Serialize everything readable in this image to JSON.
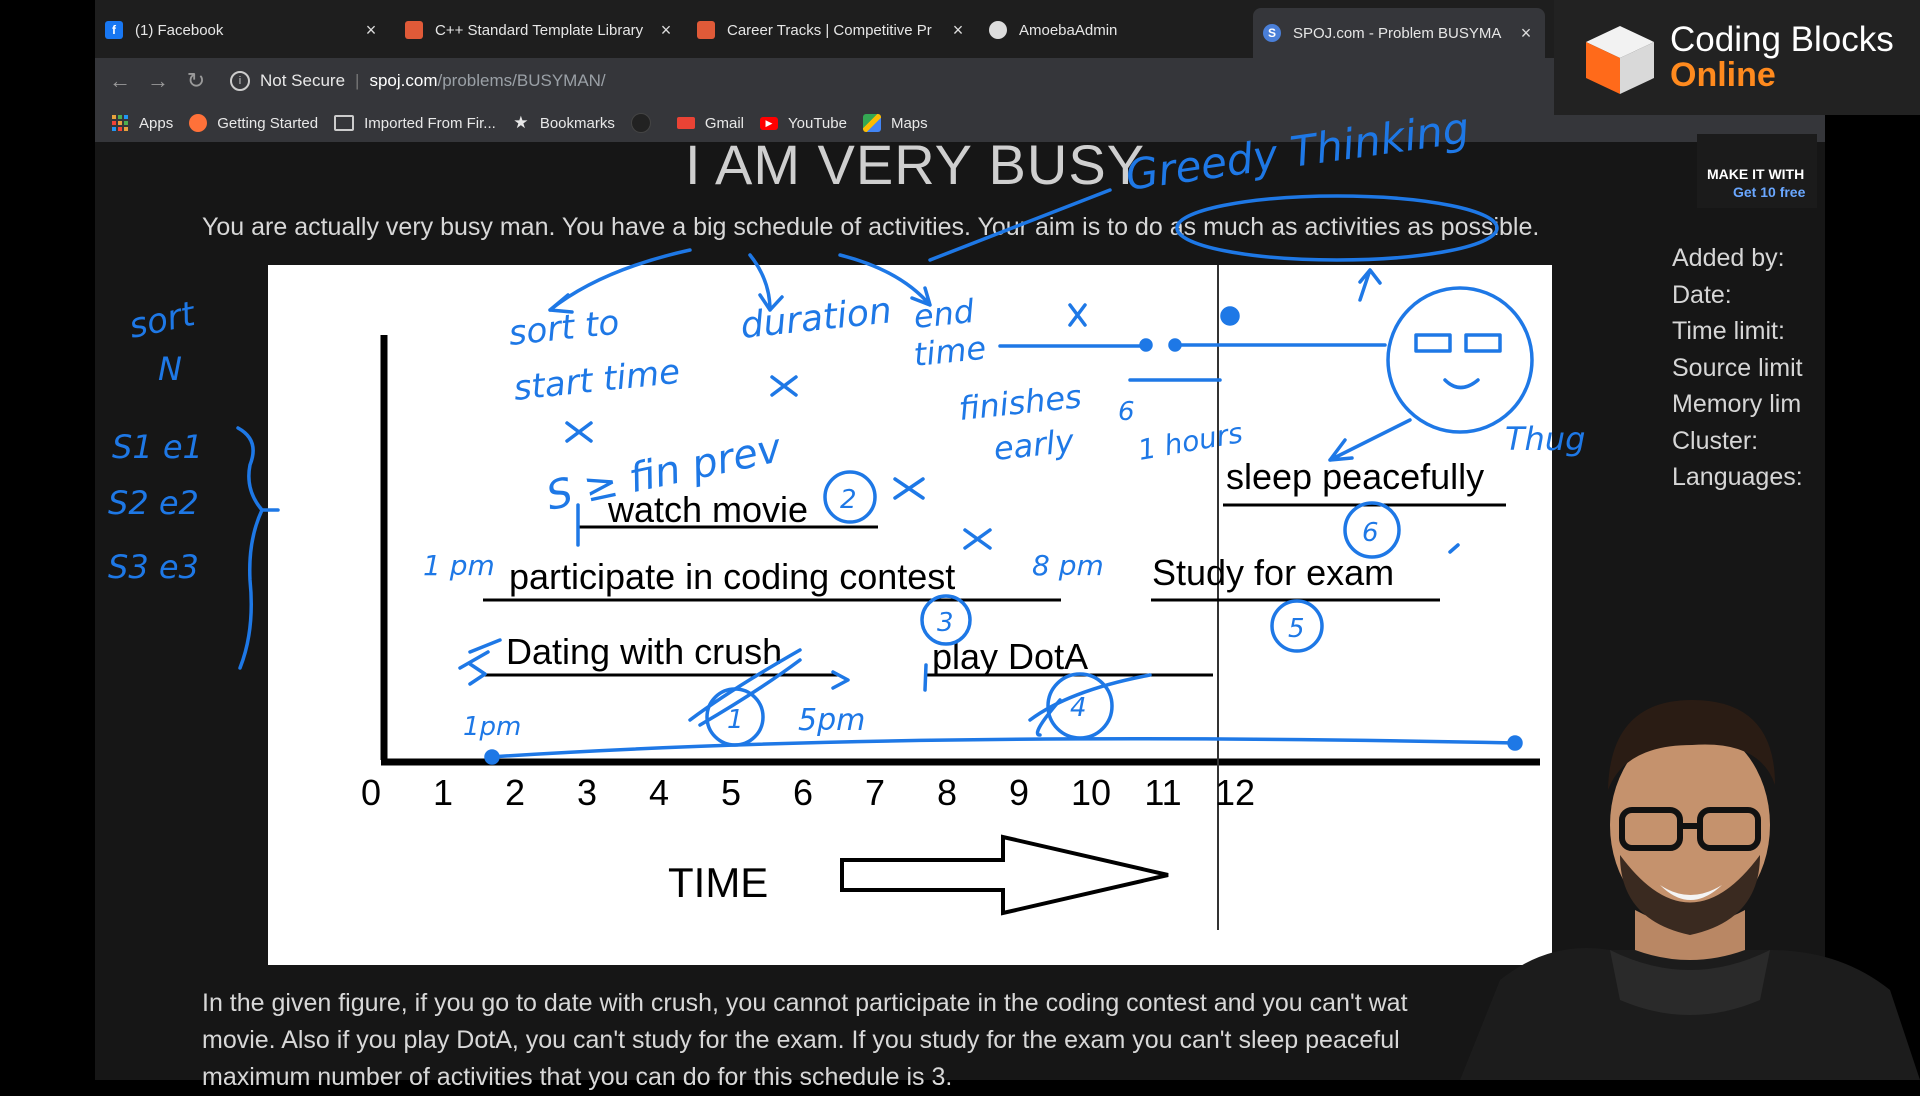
{
  "tabs": [
    {
      "title": "(1) Facebook",
      "favicon_color": "#1877f2",
      "favicon_glyph": "f"
    },
    {
      "title": "C++ Standard Template Library",
      "favicon_color": "#e05a38",
      "favicon_glyph": ""
    },
    {
      "title": "Career Tracks | Competitive Pr",
      "favicon_color": "#e05a38",
      "favicon_glyph": ""
    },
    {
      "title": "AmoebaAdmin",
      "favicon_color": "#dcdcdc",
      "favicon_glyph": ""
    },
    {
      "title": "SPOJ.com - Problem BUSYMA",
      "favicon_color": "#4a7fd8",
      "favicon_glyph": "S"
    }
  ],
  "address_bar": {
    "security": "Not Secure",
    "host": "spoj.com",
    "path": "/problems/BUSYMAN/"
  },
  "bookmarks": [
    {
      "label": "Apps",
      "icon": "apps-grid-icon"
    },
    {
      "label": "Getting Started",
      "icon": "firefox-icon"
    },
    {
      "label": "Imported From Fir...",
      "icon": "folder-icon"
    },
    {
      "label": "Bookmarks",
      "icon": "star-icon"
    },
    {
      "label": "",
      "icon": "github-icon"
    },
    {
      "label": "Gmail",
      "icon": "gmail-icon"
    },
    {
      "label": "YouTube",
      "icon": "youtube-icon"
    },
    {
      "label": "Maps",
      "icon": "maps-icon"
    }
  ],
  "problem": {
    "title": "I AM VERY BUSY",
    "intro": "You are actually very busy man. You have a big schedule of activities. Your aim is to do as much as activities as possible.",
    "meta_labels": [
      "Added by:",
      "Date:",
      "Time limit:",
      "Source limit",
      "Memory lim",
      "Cluster:",
      "Languages:"
    ],
    "description_lines": [
      "In the given figure, if you go to date with crush, you cannot participate in the coding contest and you can't wat",
      "movie. Also if you play DotA, you can't study for the exam. If you study for the exam you can't sleep peaceful",
      "maximum number of activities that you can do for this schedule is 3."
    ]
  },
  "ad": {
    "line1": "MAKE IT WITH",
    "line2": "Get 10 free"
  },
  "figure": {
    "activities": {
      "watch": "watch movie",
      "contest": "participate in coding contest",
      "dating": "Dating with crush",
      "dota": "play DotA",
      "sleep": "sleep peacefully",
      "study": "Study for exam"
    },
    "ticks": [
      "0",
      "1",
      "2",
      "3",
      "4",
      "5",
      "6",
      "7",
      "8",
      "9",
      "10",
      "11",
      "12"
    ],
    "time_label": "TIME"
  },
  "annotations": {
    "greedy": "Greedy Thinking",
    "sort_n": [
      "sort",
      "N"
    ],
    "pairs": [
      "S1 e1",
      "S2 e2",
      "S3 e3"
    ],
    "sort_start": [
      "sort to",
      "start time"
    ],
    "duration": "duration",
    "end_time": [
      "end",
      "time"
    ],
    "finishes": [
      "finishes",
      "early"
    ],
    "fin_prev": "S ≥ fin prev",
    "hours": [
      "6",
      "1 hours"
    ],
    "thug": "Thug",
    "one_pm_a": "1 pm",
    "one_pm_b": "1pm",
    "eight_pm": "8 pm",
    "five_pm": "5pm",
    "circles": [
      "1",
      "2",
      "3",
      "4",
      "5",
      "6"
    ]
  },
  "logo": {
    "line1": "Coding Blocks",
    "line2": "Online",
    "accent": "#ff8a1e"
  },
  "colors": {
    "annotation": "#1e78e6",
    "page_bg": "#161616",
    "figure_bg": "#ffffff"
  }
}
